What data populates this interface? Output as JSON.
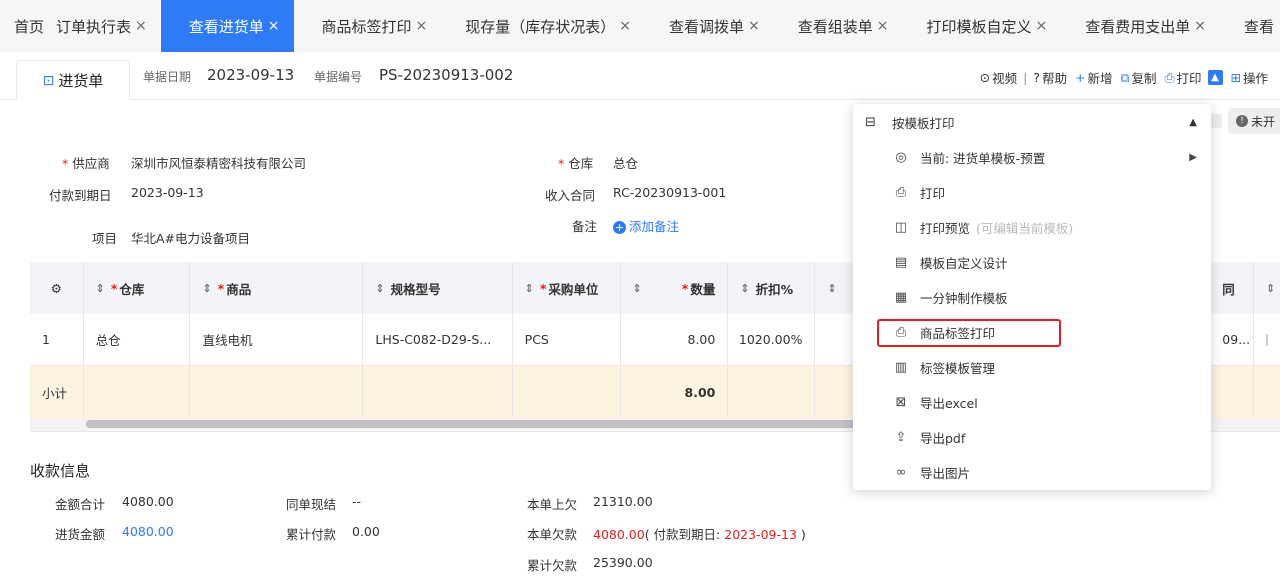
{
  "tabs": [
    {
      "label": "首页",
      "closable": false
    },
    {
      "label": "订单执行表",
      "closable": true
    },
    {
      "label": "查看进货单",
      "closable": true,
      "active": true
    },
    {
      "label": "商品标签打印",
      "closable": true
    },
    {
      "label": "现存量（库存状况表）",
      "closable": true
    },
    {
      "label": "查看调拨单",
      "closable": true
    },
    {
      "label": "查看组装单",
      "closable": true
    },
    {
      "label": "打印模板自定义",
      "closable": true
    },
    {
      "label": "查看费用支出单",
      "closable": true
    },
    {
      "label": "查看",
      "closable": false
    }
  ],
  "close_glyph": "×",
  "header": {
    "doc_tab": "进货单",
    "date_label": "单据日期",
    "date_value": "2023-09-13",
    "no_label": "单据编号",
    "no_value": "PS-20230913-002",
    "actions": {
      "video": "视频",
      "sep": "|",
      "help": "帮助",
      "add": "新增",
      "copy": "复制",
      "print": "打印",
      "ops": "操作"
    },
    "status_pill": "未开"
  },
  "form": {
    "supplier_label": "供应商",
    "supplier_value": "深圳市风恒泰精密科技有限公司",
    "due_label": "付款到期日",
    "due_value": "2023-09-13",
    "project_label": "项目",
    "project_value": "华北A#电力设备项目",
    "warehouse_label": "仓库",
    "warehouse_value": "总仓",
    "contract_label": "收入合同",
    "contract_value": "RC-20230913-001",
    "note_label": "备注",
    "note_add": "添加备注"
  },
  "table": {
    "headers": [
      "仓库",
      "商品",
      "规格型号",
      "采购单位",
      "数量",
      "折扣%",
      "同"
    ],
    "rows": [
      {
        "idx": "1",
        "warehouse": "总仓",
        "product": "直线电机",
        "spec": "LHS-C082-D29-S...",
        "unit": "PCS",
        "qty": "8.00",
        "discount": "1020.00%",
        "extra": "09..."
      }
    ],
    "subtotal_label": "小计",
    "subtotal_qty": "8.00"
  },
  "payment": {
    "title": "收款信息",
    "total_label": "金额合计",
    "total_value": "4080.00",
    "purchase_label": "进货金额",
    "purchase_value": "4080.00",
    "same_label": "同单现结",
    "same_value": "--",
    "cum_paid_label": "累计付款",
    "cum_paid_value": "0.00",
    "prev_label": "本单上欠",
    "prev_value": "21310.00",
    "owe_label": "本单欠款",
    "owe_value": "4080.00",
    "owe_open": "( 付款到期日: ",
    "owe_date": "2023-09-13",
    "owe_close": " )",
    "cum_owe_label": "累计欠款",
    "cum_owe_value": "25390.00"
  },
  "menu": {
    "head": "按模板打印",
    "items": [
      {
        "label": "当前: 进货单模板-预置",
        "icon": "template-select-icon",
        "submenu": true
      },
      {
        "label": "打印",
        "icon": "printer-icon"
      },
      {
        "label": "打印预览",
        "hint": "(可编辑当前模板)",
        "icon": "preview-icon"
      },
      {
        "label": "模板自定义设计",
        "icon": "design-icon"
      },
      {
        "label": "一分钟制作模板",
        "icon": "quick-template-icon"
      },
      {
        "label": "商品标签打印",
        "icon": "label-print-icon",
        "highlighted": true
      },
      {
        "label": "标签模板管理",
        "icon": "label-manage-icon"
      },
      {
        "label": "导出excel",
        "icon": "excel-export-icon"
      },
      {
        "label": "导出pdf",
        "icon": "pdf-export-icon"
      },
      {
        "label": "导出图片",
        "icon": "image-export-icon"
      }
    ]
  },
  "colors": {
    "accent": "#2f7bf5",
    "required": "#e02020",
    "subtotal_bg": "#fdf3e1"
  }
}
